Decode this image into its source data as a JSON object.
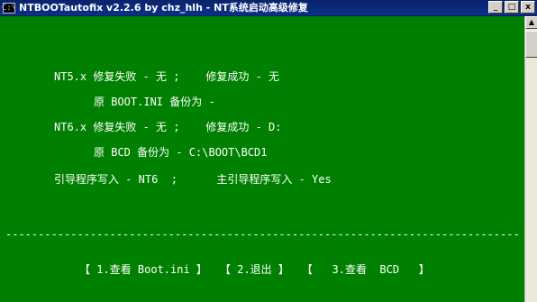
{
  "window": {
    "title": "NTBOOTautofix v2.2.6 by chz_hlh - NT系统启动高级修复",
    "icon_text": "C:\\",
    "controls": {
      "minimize": "_",
      "maximize": "□",
      "close": "x"
    }
  },
  "console": {
    "lines": [
      "NT5.x 修复失败 - 无 ;    修复成功 - 无",
      "原 BOOT.INI 备份为 -",
      "NT6.x 修复失败 - 无 ;    修复成功 - D:",
      "原 BCD 备份为 - C:\\BOOT\\BCD1",
      "引导程序写入 - NT6  ;      主引导程序写入 - Yes"
    ],
    "separator": "------------------------------------------------------------------------------------------------------------",
    "menu": [
      "【 1.查看 Boot.ini 】",
      "【 2.退出 】",
      "【   3.查看  BCD   】"
    ]
  },
  "colors": {
    "console_bg": "#008000",
    "console_fg": "#ffffff",
    "titlebar": "#0a246a"
  },
  "icons": {
    "window_icon": "console-window-icon",
    "scroll_up": "triangle-up"
  }
}
